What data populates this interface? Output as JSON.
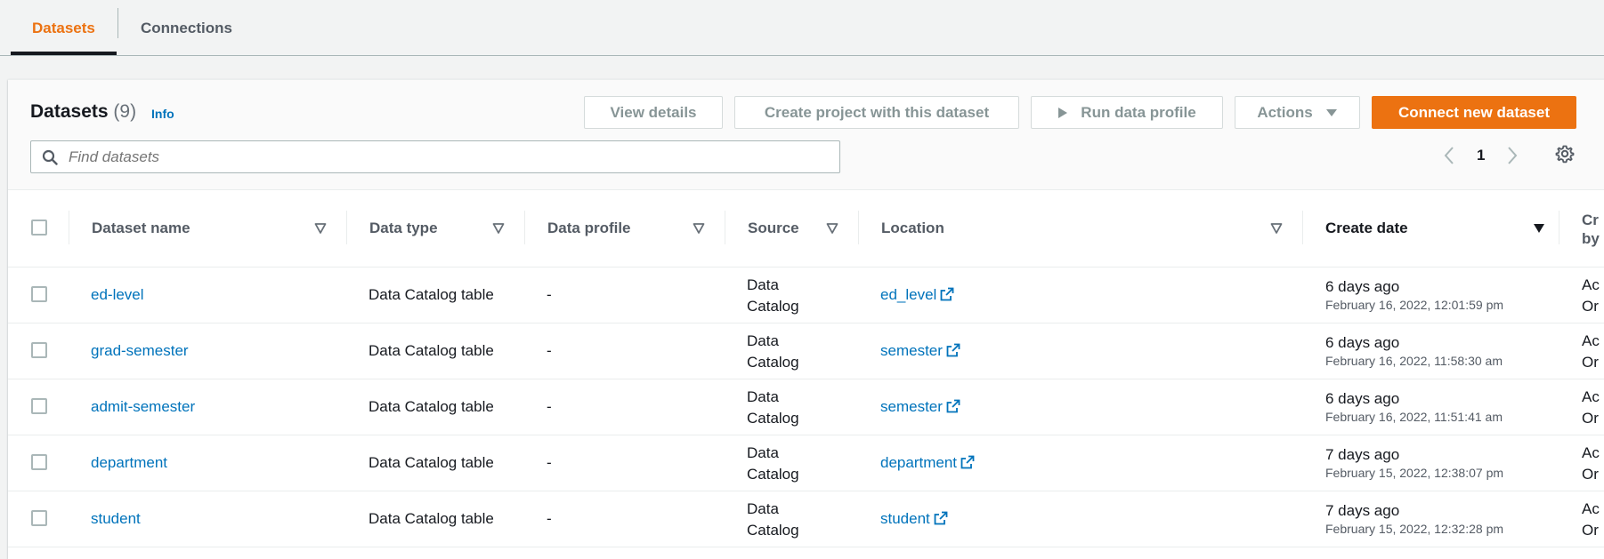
{
  "tabs": [
    {
      "label": "Datasets",
      "active": true
    },
    {
      "label": "Connections",
      "active": false
    }
  ],
  "header": {
    "title": "Datasets",
    "count": "(9)",
    "info": "Info",
    "search_placeholder": "Find datasets",
    "page": "1"
  },
  "toolbar": {
    "view_details": "View details",
    "create_project": "Create project with this dataset",
    "run_profile": "Run data profile",
    "actions": "Actions",
    "connect": "Connect new dataset"
  },
  "columns": {
    "name": "Dataset name",
    "type": "Data type",
    "profile": "Data profile",
    "source": "Source",
    "location": "Location",
    "create_date": "Create date",
    "created_by_1": "Cr",
    "created_by_2": "by"
  },
  "rows": [
    {
      "name": "ed-level",
      "type": "Data Catalog table",
      "profile": "-",
      "source_1": "Data",
      "source_2": "Catalog",
      "location": "ed_level",
      "date_rel": "6 days ago",
      "date_abs": "February 16, 2022, 12:01:59 pm",
      "by_1": "Ac",
      "by_2": "Or"
    },
    {
      "name": "grad-semester",
      "type": "Data Catalog table",
      "profile": "-",
      "source_1": "Data",
      "source_2": "Catalog",
      "location": "semester",
      "date_rel": "6 days ago",
      "date_abs": "February 16, 2022, 11:58:30 am",
      "by_1": "Ac",
      "by_2": "Or"
    },
    {
      "name": "admit-semester",
      "type": "Data Catalog table",
      "profile": "-",
      "source_1": "Data",
      "source_2": "Catalog",
      "location": "semester",
      "date_rel": "6 days ago",
      "date_abs": "February 16, 2022, 11:51:41 am",
      "by_1": "Ac",
      "by_2": "Or"
    },
    {
      "name": "department",
      "type": "Data Catalog table",
      "profile": "-",
      "source_1": "Data",
      "source_2": "Catalog",
      "location": "department",
      "date_rel": "7 days ago",
      "date_abs": "February 15, 2022, 12:38:07 pm",
      "by_1": "Ac",
      "by_2": "Or"
    },
    {
      "name": "student",
      "type": "Data Catalog table",
      "profile": "-",
      "source_1": "Data",
      "source_2": "Catalog",
      "location": "student",
      "date_rel": "7 days ago",
      "date_abs": "February 15, 2022, 12:32:28 pm",
      "by_1": "Ac",
      "by_2": "Or"
    }
  ],
  "colors": {
    "accent": "#ec7211",
    "link": "#0073bb"
  }
}
